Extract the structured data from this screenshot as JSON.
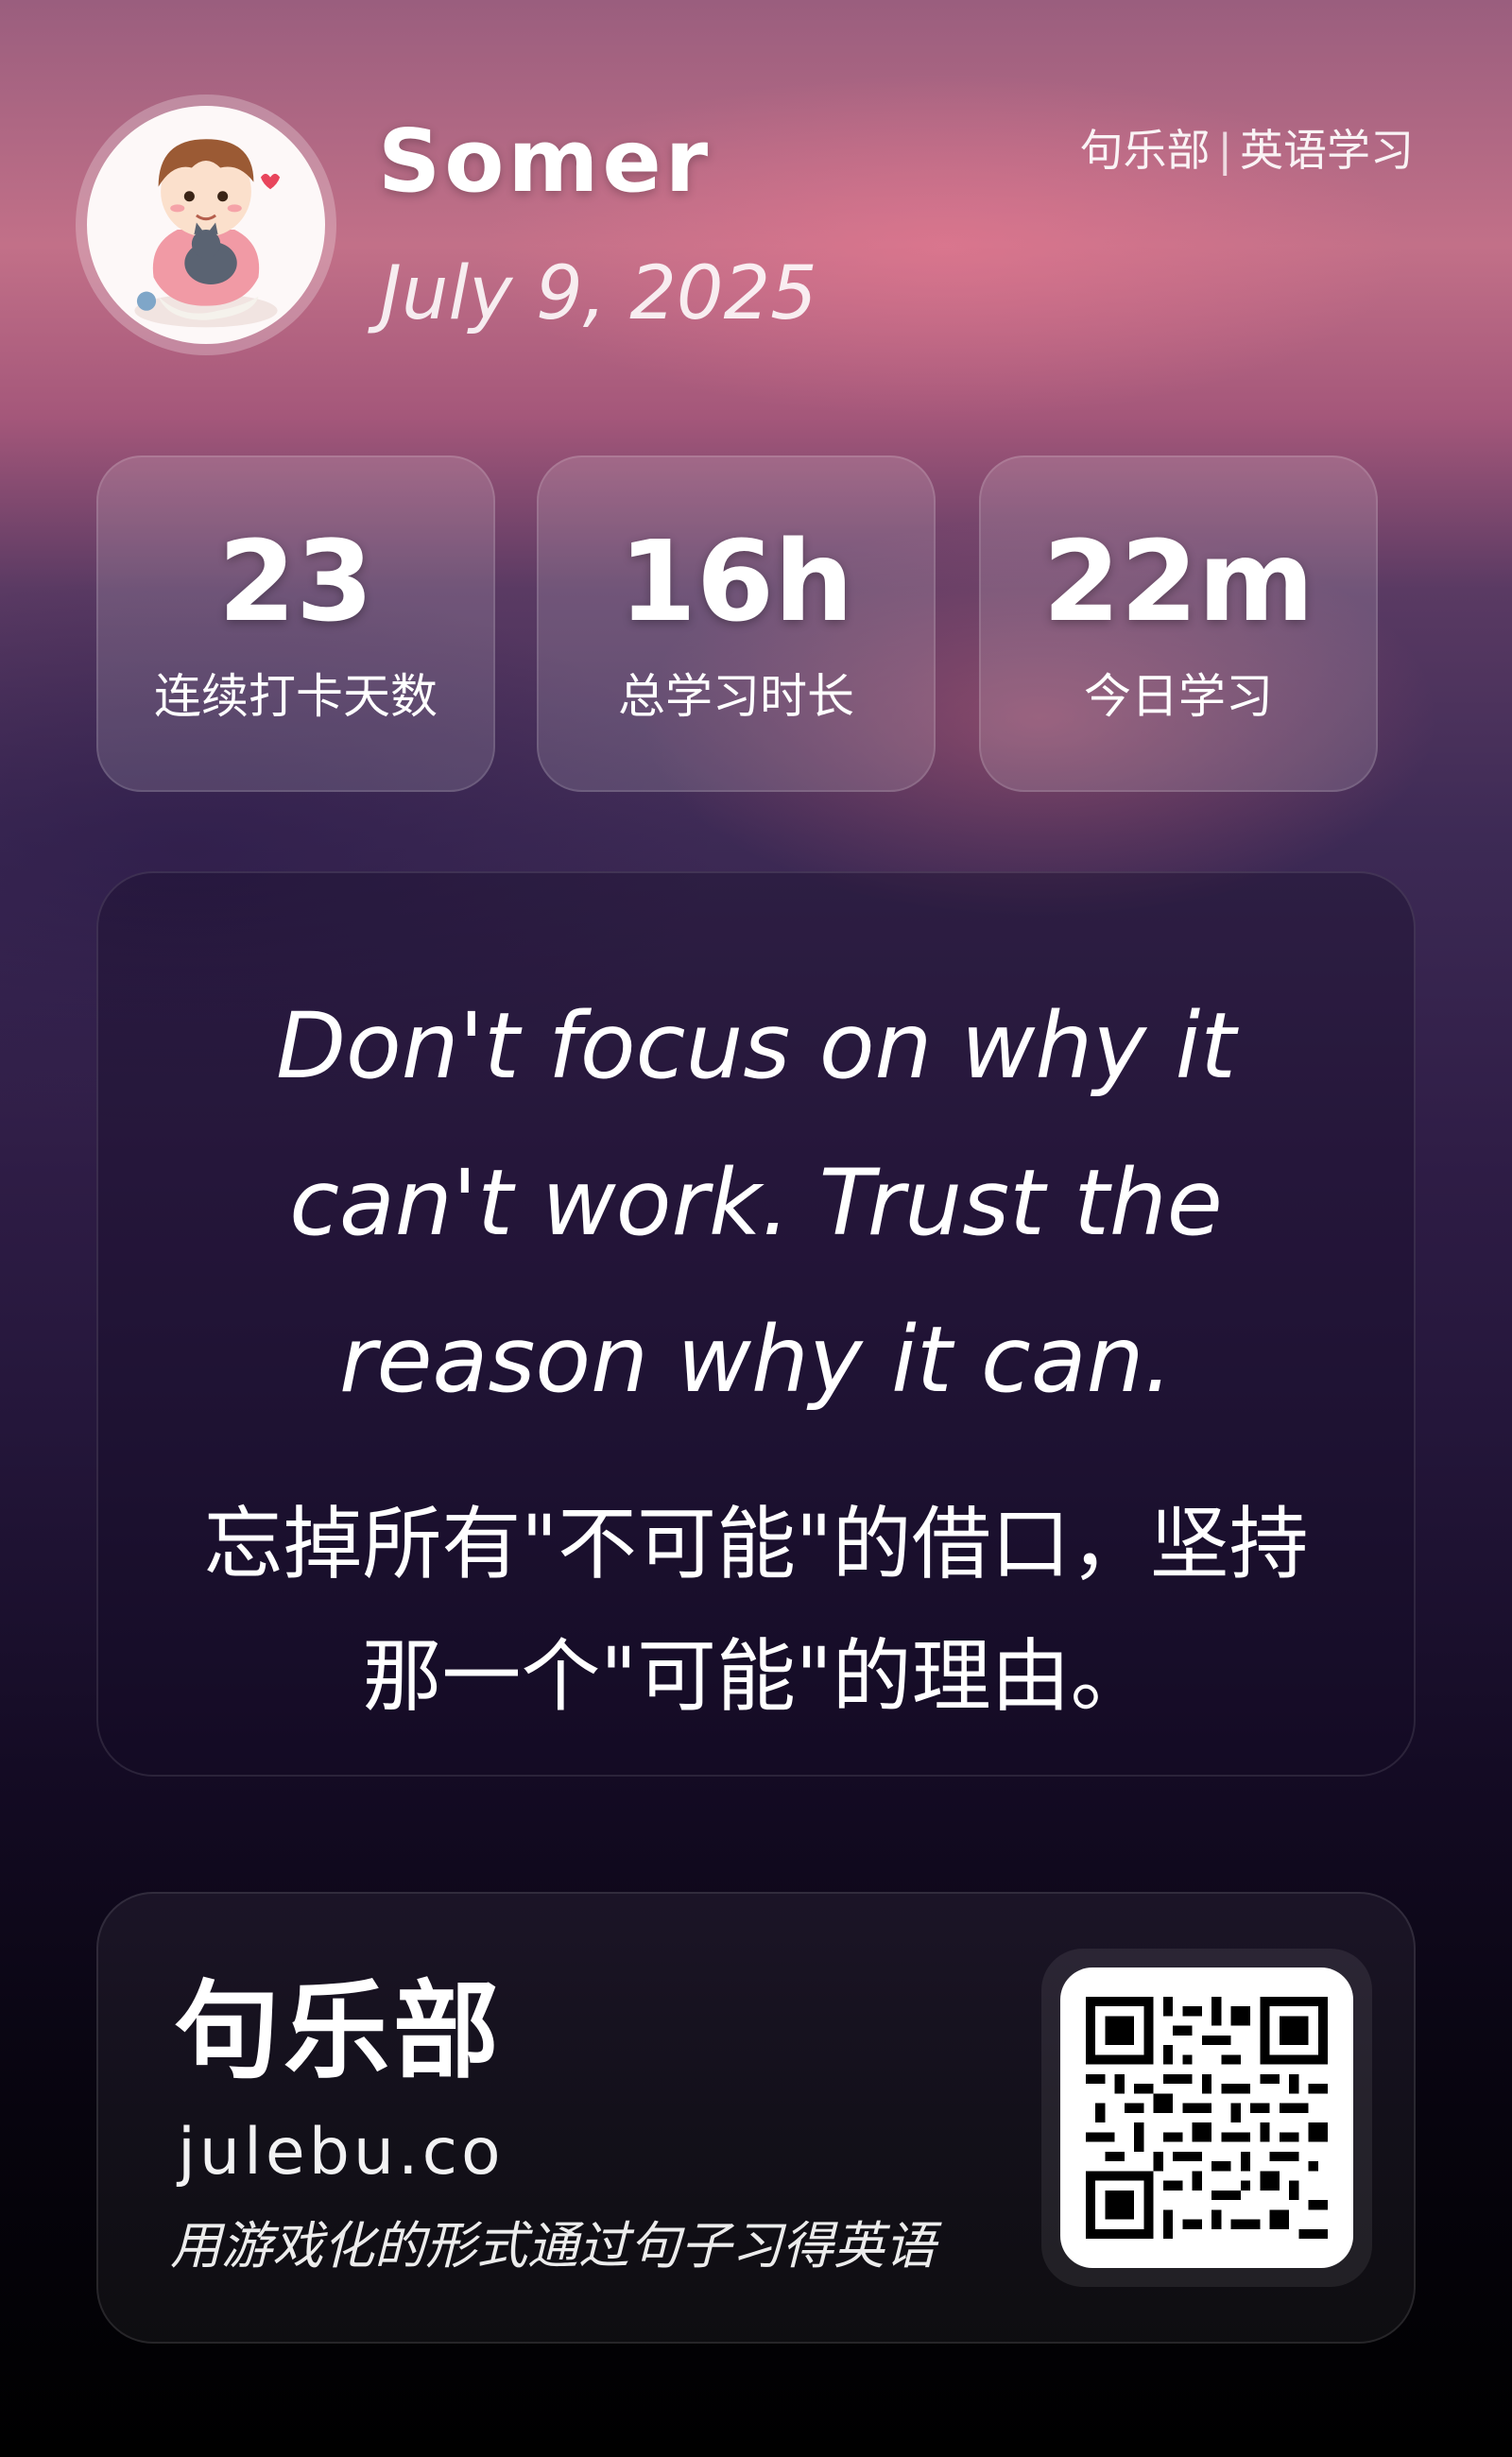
{
  "profile": {
    "username": "Somer",
    "date": "July 9, 2025",
    "avatar_icon": "cartoon-boy-with-cat-icon"
  },
  "brand_tag": {
    "brand": "句乐部",
    "separator": "|",
    "category": "英语学习"
  },
  "stats": [
    {
      "value": "23",
      "label": "连续打卡天数"
    },
    {
      "value": "16h",
      "label": "总学习时长"
    },
    {
      "value": "22m",
      "label": "今日学习"
    }
  ],
  "quote": {
    "english": "Don't focus on why it can't work. Trust the reason why it can.",
    "chinese": "忘掉所有\"不可能\"的借口，坚持那一个\"可能\"的理由。"
  },
  "footer": {
    "title": "句乐部",
    "url": "julebu.co",
    "slogan": "用游戏化的形式通过句子习得英语",
    "qr_icon": "qr-code-icon"
  },
  "colors": {
    "top_background": "#c27088",
    "bottom_background": "#000000",
    "text": "#ffffff"
  }
}
